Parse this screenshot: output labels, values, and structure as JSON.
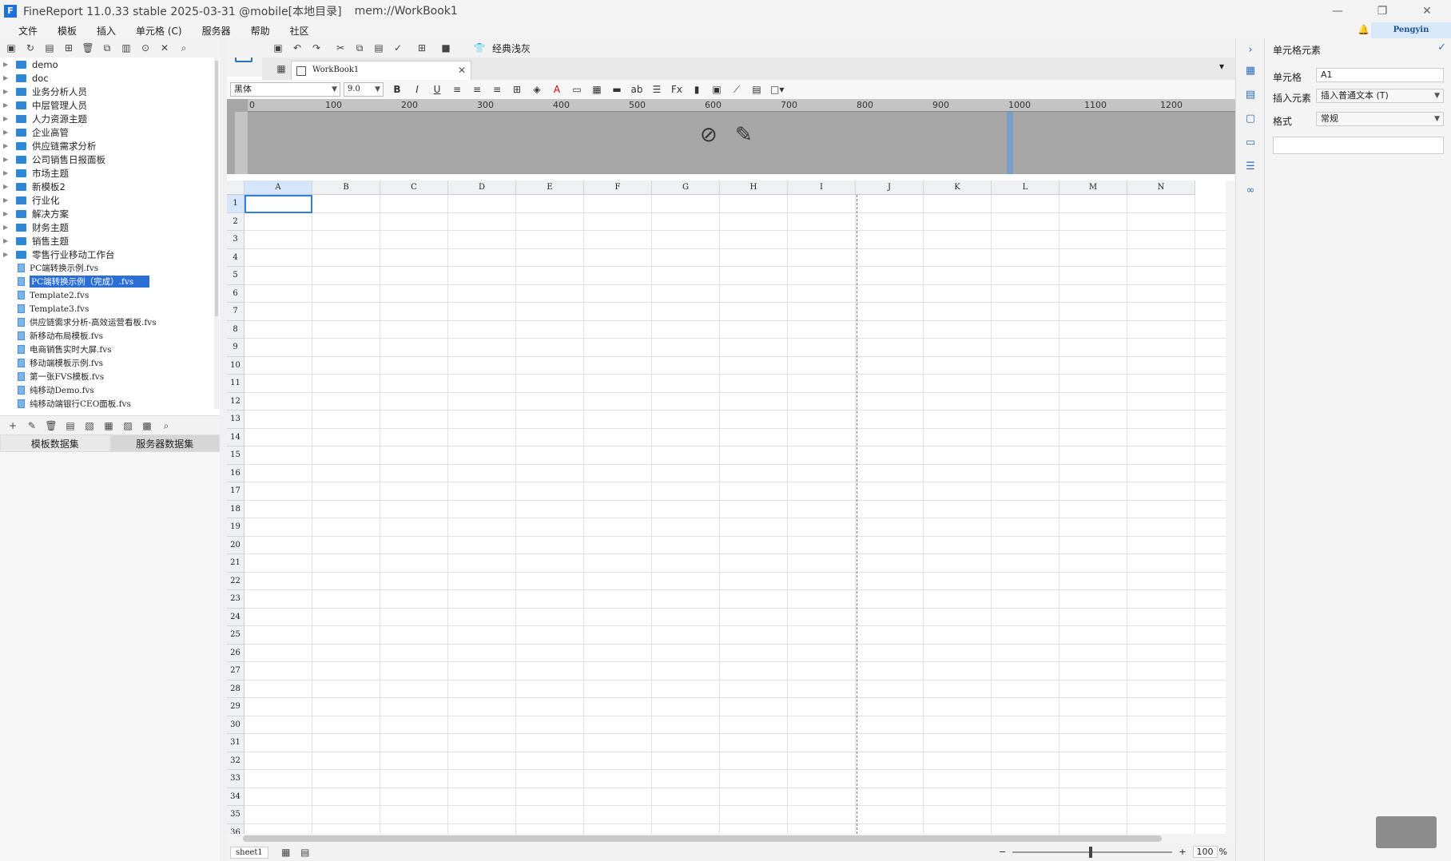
{
  "title": {
    "app": "FineReport 11.0.33 stable 2025-03-31 @mobile[本地目录]",
    "doc": "mem://WorkBook1"
  },
  "menu": [
    "文件",
    "模板",
    "插入",
    "单元格 (C)",
    "服务器",
    "帮助",
    "社区"
  ],
  "user": "Pengyin",
  "tree": {
    "folders": [
      "demo",
      "doc",
      "业务分析人员",
      "中层管理人员",
      "人力资源主题",
      "企业高管",
      "供应链需求分析",
      "公司销售日报面板",
      "市场主题",
      "新模板2",
      "行业化",
      "解决方案",
      "财务主题",
      "销售主题",
      "零售行业移动工作台"
    ],
    "files": [
      "PC端转换示例.fvs",
      "PC端转换示例（完成）.fvs",
      "Template2.fvs",
      "Template3.fvs",
      "供应链需求分析-高效运营看板.fvs",
      "新移动布局模板.fvs",
      "电商销售实时大屏.fvs",
      "移动端模板示例.fvs",
      "第一张FVS模板.fvs",
      "纯移动Demo.fvs",
      "纯移动端银行CEO面板.fvs"
    ],
    "selected_file": "PC端转换示例（完成）.fvs"
  },
  "dataset_tabs": [
    "模板数据集",
    "服务器数据集"
  ],
  "toolbar": {
    "theme_label": "经典浅灰"
  },
  "tab": {
    "name": "WorkBook1"
  },
  "format": {
    "font": "黑体",
    "size": "9.0"
  },
  "ruler": [
    "0",
    "100",
    "200",
    "300",
    "400",
    "500",
    "600",
    "700",
    "800",
    "900",
    "1000",
    "1100",
    "1200"
  ],
  "columns": [
    "A",
    "B",
    "C",
    "D",
    "E",
    "F",
    "G",
    "H",
    "I",
    "J",
    "K",
    "L",
    "M",
    "N"
  ],
  "row_count": 36,
  "sheet": {
    "name": "sheet1"
  },
  "zoom": {
    "value": "100",
    "unit": "%"
  },
  "right_panel": {
    "title": "单元格元素",
    "cell_label": "单元格",
    "cell_value": "A1",
    "insert_label": "插入元素",
    "insert_value": "插入普通文本 (T)",
    "format_label": "格式",
    "format_value": "常规"
  },
  "colors": {
    "accent": "#2f7fe6",
    "folder": "#2f86d4",
    "selected_row": "#2b6fd6"
  }
}
